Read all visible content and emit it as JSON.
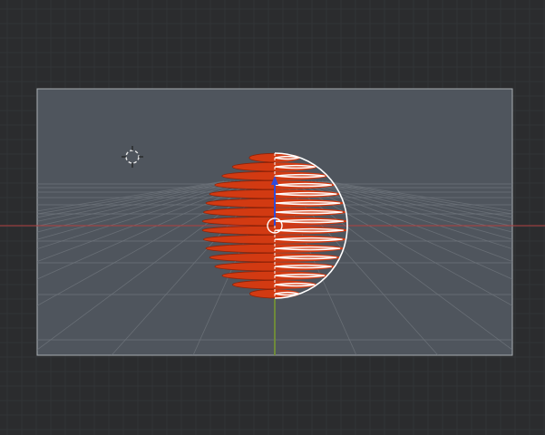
{
  "viewport": {
    "background": "#2b2c2e",
    "camera_frame_fill": "#4f555d",
    "camera_frame_border": "#a9aeb3",
    "grid_color": "#6f757c",
    "x_axis_color": "#b0403f",
    "y_axis_color": "#6f8a3a",
    "z_axis_color": "#2e4bdb",
    "object_color": "#d23a12",
    "selection_outline_color": "#ffffff",
    "mode": "camera-view"
  },
  "object": {
    "name": "",
    "shape": "sphere",
    "style": "horizontal-slices",
    "left_half": "solid-slices",
    "right_half": "selected-wire-slices"
  },
  "icons": {
    "cursor": "3d-cursor-icon",
    "origin": "object-origin-icon",
    "gizmo": "transform-gizmo-icon"
  }
}
